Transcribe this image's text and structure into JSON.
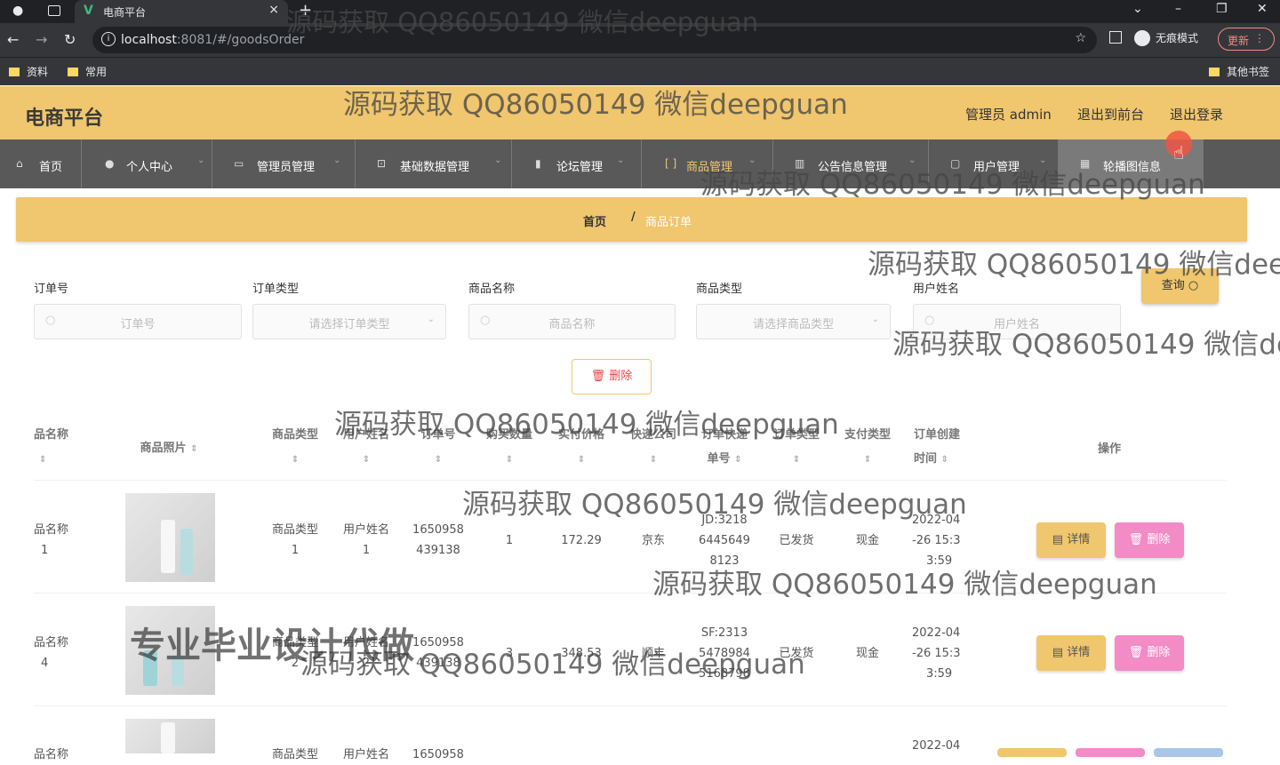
{
  "browser": {
    "tab_title": "电商平台",
    "url_host": "localhost",
    "url_rest": ":8081/#/goodsOrder",
    "incognito_label": "无痕模式",
    "update_label": "更新",
    "bookmarks": [
      "资料",
      "常用"
    ],
    "other_bookmarks": "其他书签"
  },
  "header": {
    "brand": "电商平台",
    "admin": "管理员 admin",
    "to_front": "退出到前台",
    "logout": "退出登录"
  },
  "menu": [
    {
      "label": "首页",
      "icon": "home-icon"
    },
    {
      "label": "个人中心",
      "icon": "user-icon"
    },
    {
      "label": "管理员管理",
      "icon": "admin-icon"
    },
    {
      "label": "基础数据管理",
      "icon": "crop-icon"
    },
    {
      "label": "论坛管理",
      "icon": "mic-icon"
    },
    {
      "label": "商品管理",
      "icon": "goods-icon"
    },
    {
      "label": "公告信息管理",
      "icon": "notice-icon"
    },
    {
      "label": "用户管理",
      "icon": "users-icon"
    },
    {
      "label": "轮播图信息",
      "icon": "carousel-icon"
    }
  ],
  "breadcrumb": {
    "home": "首页",
    "sep": "/",
    "current": "商品订单"
  },
  "search": {
    "fields": [
      {
        "label": "订单号",
        "placeholder": "订单号"
      },
      {
        "label": "订单类型",
        "placeholder": "请选择订单类型"
      },
      {
        "label": "商品名称",
        "placeholder": "商品名称"
      },
      {
        "label": "商品类型",
        "placeholder": "请选择商品类型"
      },
      {
        "label": "用户姓名",
        "placeholder": "用户姓名"
      }
    ],
    "query_label": "查询",
    "delete_label": "删除"
  },
  "table": {
    "headers": [
      "品名称",
      "商品照片",
      "商品类型",
      "用户姓名",
      "订单号",
      "购买数量",
      "实付价格",
      "快递公司",
      "订单快递",
      "单号",
      "订单类型",
      "支付类型",
      "订单创建",
      "时间",
      "操作"
    ],
    "rows": [
      {
        "name1": "品名称",
        "name2": "1",
        "type1": "商品类型",
        "type2": "1",
        "user1": "用户姓名",
        "user2": "1",
        "order1": "1650958",
        "order2": "439138",
        "qty": "1",
        "price": "172.29",
        "express": "京东",
        "track1": "JD:3218",
        "track2": "6445649",
        "track3": "8123",
        "otype": "已发货",
        "pay": "现金",
        "time1": "2022-04",
        "time2": "-26 15:3",
        "time3": "3:59"
      },
      {
        "name1": "品名称",
        "name2": "4",
        "type1": "商品类型",
        "type2": "2",
        "user1": "用户姓名",
        "user2": "2",
        "order1": "1650958",
        "order2": "439138",
        "qty": "3",
        "price": "348.53",
        "express": "顺丰",
        "track1": "SF:2313",
        "track2": "5478984",
        "track3": "5168798",
        "otype": "已发货",
        "pay": "现金",
        "time1": "2022-04",
        "time2": "-26 15:3",
        "time3": "3:59"
      },
      {
        "name1": "品名称",
        "type1": "商品类型",
        "user1": "用户姓名",
        "order1": "1650958",
        "time1": "2022-04"
      }
    ],
    "detail_label": "详情",
    "delete_label": "删除"
  },
  "watermark": "源码获取 QQ86050149 微信deepguan",
  "watermark_partial_1": "源码获取 QQ86050149 微信deep",
  "watermark_partial_2": "源码获取 QQ86050149 微信dee",
  "watermark_big": "专业毕业设计代做"
}
